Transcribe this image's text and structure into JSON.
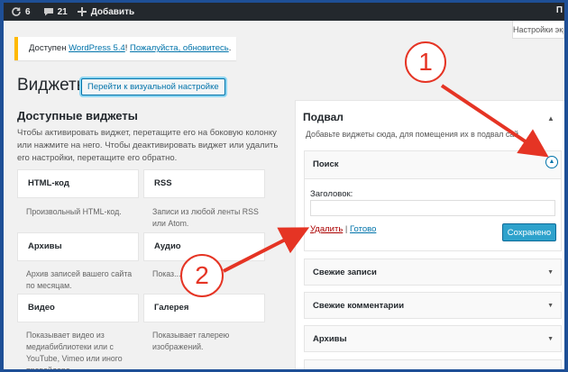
{
  "admin_bar": {
    "updates_count": "6",
    "comments_count": "21",
    "add_label": "Добавить"
  },
  "screen_options": "Настройки экр",
  "right_edge_fragment": "П",
  "notice": {
    "prefix": "Доступен ",
    "link1": "WordPress 5.4",
    "middle": "! ",
    "link2": "Пожалуйста, обновитесь",
    "suffix": "."
  },
  "page": {
    "title": "Виджеты",
    "visual_button": "Перейти к визуальной настройке"
  },
  "available": {
    "title": "Доступные виджеты",
    "description": "Чтобы активировать виджет, перетащите его на боковую колонку или нажмите на него. Чтобы деактивировать виджет или удалить его настройки, перетащите его обратно."
  },
  "widgets": [
    {
      "name": "HTML-код",
      "desc": "Произвольный HTML-код."
    },
    {
      "name": "RSS",
      "desc": "Записи из любой ленты RSS или Atom."
    },
    {
      "name": "Архивы",
      "desc": "Архив записей вашего сайта по месяцам."
    },
    {
      "name": "Аудио",
      "desc": "Показ... прогр..."
    },
    {
      "name": "Видео",
      "desc": "Показывает видео из медиабиблиотеки или с YouTube, Vimeo или иного провайдера."
    },
    {
      "name": "Галерея",
      "desc": "Показывает галерею изображений."
    }
  ],
  "sidebar": {
    "title": "Подвал",
    "description": "Добавьте виджеты сюда, для помещения их в подвал сай",
    "open_widget": {
      "name": "Поиск",
      "field_label": "Заголовок:",
      "field_value": "",
      "delete_link": "Удалить",
      "separator": "|",
      "done_link": "Готово",
      "save_button": "Сохранено"
    },
    "widgets": [
      "Свежие записи",
      "Свежие комментарии",
      "Архивы"
    ]
  },
  "annotations": {
    "marker1": "1",
    "marker2": "2"
  },
  "colors": {
    "arrow": "#e53424",
    "accent": "#0073aa",
    "admin_bar": "#23282d",
    "frame": "#1e4f96"
  }
}
